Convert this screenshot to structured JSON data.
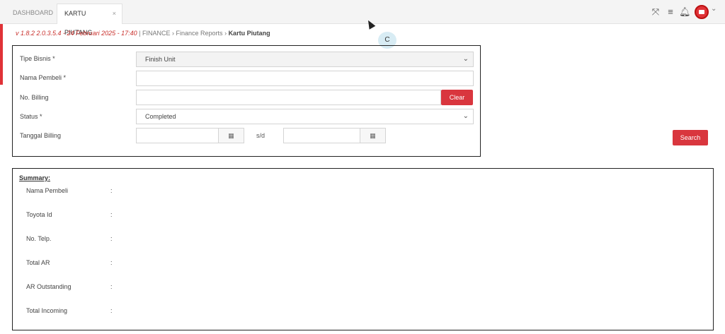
{
  "tabs": [
    {
      "label": "DASHBOARD"
    },
    {
      "label": "KARTU PIUTANG",
      "close": "×"
    }
  ],
  "header_icons": [
    "expand-icon",
    "menu-icon",
    "bell-icon",
    "avatar",
    "chevron-down-icon"
  ],
  "breadcrumb": {
    "version": "v 1.8.2 2.0.3.5.4 - 24 Februari 2025 - 17:40",
    "sep": " | ",
    "items": [
      "FINANCE",
      "Finance Reports",
      "Kartu Piutang"
    ]
  },
  "cursor_badge": "C",
  "form": {
    "tipe_bisnis": {
      "label": "Tipe Bisnis *",
      "value": "Finish Unit"
    },
    "nama_pembeli": {
      "label": "Nama Pembeli *",
      "value": ""
    },
    "no_billing": {
      "label": "No. Billing",
      "value": "",
      "clear_label": "Clear"
    },
    "status": {
      "label": "Status *",
      "value": "Completed"
    },
    "tanggal_billing": {
      "label": "Tanggal Billing",
      "separator": "s/d",
      "from": "",
      "to": ""
    }
  },
  "search_label": "Search",
  "summary": {
    "title": "Summary:",
    "rows": [
      {
        "label": "Nama Pembeli",
        "value": ""
      },
      {
        "label": "Toyota Id",
        "value": ""
      },
      {
        "label": "No. Telp.",
        "value": ""
      },
      {
        "label": "Total AR",
        "value": ""
      },
      {
        "label": "AR Outstanding",
        "value": ""
      },
      {
        "label": "Total Incoming",
        "value": ""
      }
    ]
  },
  "colors": {
    "accent": "#d9363e"
  }
}
